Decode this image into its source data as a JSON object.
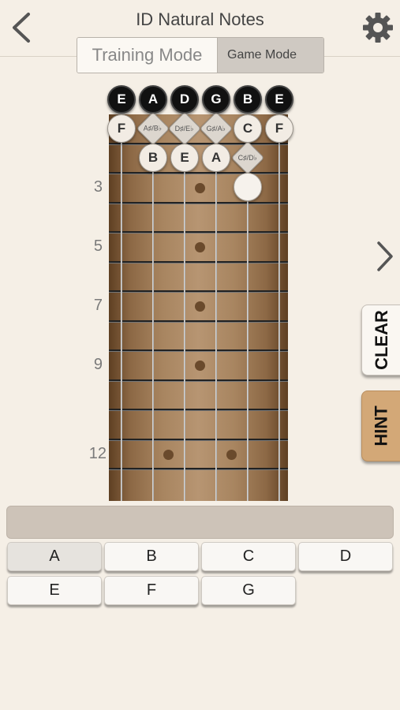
{
  "header": {
    "title": "ID Natural Notes",
    "back_icon": "chevron-left-icon",
    "settings_icon": "gear-icon"
  },
  "mode_switch": {
    "training": "Training Mode",
    "game": "Game Mode",
    "selected": "Game Mode"
  },
  "fretboard": {
    "open_strings": [
      "E",
      "A",
      "D",
      "G",
      "B",
      "E"
    ],
    "fret1_notes": [
      "F",
      "A♯/B♭",
      "D♯/E♭",
      "G♯/A♭",
      "C",
      "F"
    ],
    "fret2_notes": [
      "B",
      "E",
      "A",
      "C♯/D♭"
    ],
    "fret_numbers": [
      "3",
      "5",
      "7",
      "9",
      "12"
    ]
  },
  "side_buttons": {
    "clear": "CLEAR",
    "hint": "HINT",
    "next_icon": "chevron-right-icon"
  },
  "answer": {
    "value": ""
  },
  "keys": [
    "A",
    "B",
    "C",
    "D",
    "E",
    "F",
    "G"
  ],
  "colors": {
    "background": "#f5efe6",
    "hint_button": "#d3a877",
    "answer_box": "#cdc3b8"
  }
}
